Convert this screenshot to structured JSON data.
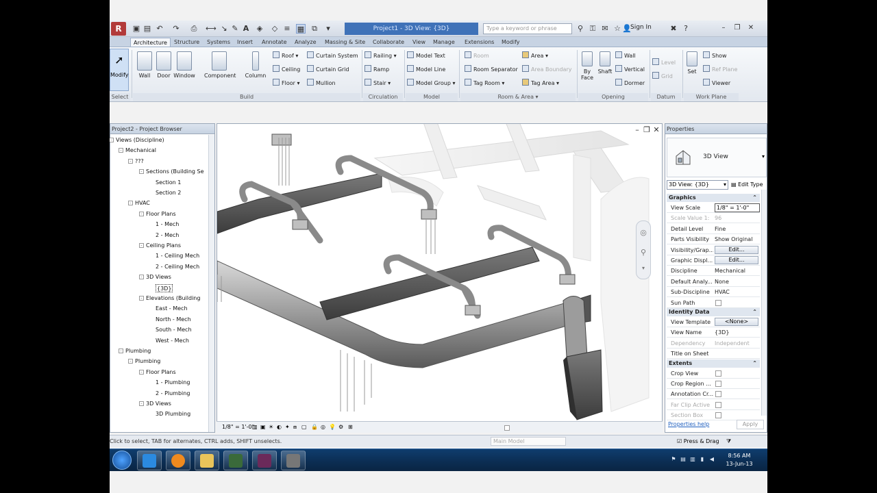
{
  "app": {
    "logo": "R",
    "document_title": "Project1 - 3D View: {3D}",
    "search_placeholder": "Type a keyword or phrase",
    "sign_in": "Sign In"
  },
  "ribbon_tabs": [
    "Architecture",
    "Structure",
    "Systems",
    "Insert",
    "Annotate",
    "Analyze",
    "Massing & Site",
    "Collaborate",
    "View",
    "Manage",
    "Extensions",
    "Modify"
  ],
  "ribbon": {
    "modify": "Modify",
    "build_tools": [
      "Wall",
      "Door",
      "Window",
      "Component",
      "Column"
    ],
    "build_small": [
      "Roof",
      "Ceiling",
      "Floor",
      "Curtain System",
      "Curtain Grid",
      "Mullion"
    ],
    "circulation": [
      "Railing",
      "Ramp",
      "Stair"
    ],
    "model": [
      "Model Text",
      "Model Line",
      "Model Group"
    ],
    "room_area": [
      "Room",
      "Room Separator",
      "Tag Room",
      "Area",
      "Area Boundary",
      "Tag Area"
    ],
    "opening": {
      "by_face": "By Face",
      "shaft": "Shaft",
      "wall": "Wall",
      "vertical": "Vertical",
      "dormer": "Dormer"
    },
    "datum": [
      "Level",
      "Grid"
    ],
    "work_plane": {
      "set": "Set",
      "show": "Show",
      "ref_plane": "Ref Plane",
      "viewer": "Viewer"
    },
    "panel_labels": [
      "Select",
      "Build",
      "Circulation",
      "Model",
      "Room & Area ▾",
      "Opening",
      "Datum",
      "Work Plane"
    ]
  },
  "browser": {
    "title": "Project2 - Project Browser",
    "items": [
      {
        "label": "Views (Discipline)",
        "level": 0,
        "twisty": "-"
      },
      {
        "label": "Mechanical",
        "level": 1,
        "twisty": "-"
      },
      {
        "label": "???",
        "level": 2,
        "twisty": "-"
      },
      {
        "label": "Sections (Building Se",
        "level": 3,
        "twisty": "-"
      },
      {
        "label": "Section 1",
        "level": 4,
        "twisty": ""
      },
      {
        "label": "Section 2",
        "level": 4,
        "twisty": ""
      },
      {
        "label": "HVAC",
        "level": 2,
        "twisty": "-"
      },
      {
        "label": "Floor Plans",
        "level": 3,
        "twisty": "-"
      },
      {
        "label": "1 - Mech",
        "level": 4,
        "twisty": ""
      },
      {
        "label": "2 - Mech",
        "level": 4,
        "twisty": ""
      },
      {
        "label": "Ceiling Plans",
        "level": 3,
        "twisty": "-"
      },
      {
        "label": "1 - Ceiling Mech",
        "level": 4,
        "twisty": ""
      },
      {
        "label": "2 - Ceiling Mech",
        "level": 4,
        "twisty": ""
      },
      {
        "label": "3D Views",
        "level": 3,
        "twisty": "-"
      },
      {
        "label": "{3D}",
        "level": 4,
        "twisty": "",
        "selected": true
      },
      {
        "label": "Elevations (Building",
        "level": 3,
        "twisty": "-"
      },
      {
        "label": "East - Mech",
        "level": 4,
        "twisty": ""
      },
      {
        "label": "North - Mech",
        "level": 4,
        "twisty": ""
      },
      {
        "label": "South - Mech",
        "level": 4,
        "twisty": ""
      },
      {
        "label": "West - Mech",
        "level": 4,
        "twisty": ""
      },
      {
        "label": "Plumbing",
        "level": 1,
        "twisty": "-"
      },
      {
        "label": "Plumbing",
        "level": 2,
        "twisty": "-"
      },
      {
        "label": "Floor Plans",
        "level": 3,
        "twisty": "-"
      },
      {
        "label": "1 - Plumbing",
        "level": 4,
        "twisty": ""
      },
      {
        "label": "2 - Plumbing",
        "level": 4,
        "twisty": ""
      },
      {
        "label": "3D Views",
        "level": 3,
        "twisty": "-"
      },
      {
        "label": "3D Plumbing",
        "level": 4,
        "twisty": ""
      }
    ]
  },
  "view": {
    "scale": "1/8\" = 1'-0\""
  },
  "properties": {
    "title": "Properties",
    "type_name": "3D View",
    "view_select": "3D View: {3D}",
    "edit_type": "Edit Type",
    "sections": [
      {
        "name": "Graphics",
        "rows": [
          {
            "k": "View Scale",
            "v": "1/8\" = 1'-0\"",
            "kind": "box"
          },
          {
            "k": "Scale Value 1:",
            "v": "96",
            "kind": "text",
            "dim": true
          },
          {
            "k": "Detail Level",
            "v": "Fine",
            "kind": "text"
          },
          {
            "k": "Parts Visibility",
            "v": "Show Original",
            "kind": "text"
          },
          {
            "k": "Visibility/Grap...",
            "v": "Edit...",
            "kind": "btn"
          },
          {
            "k": "Graphic Displ...",
            "v": "Edit...",
            "kind": "btn"
          },
          {
            "k": "Discipline",
            "v": "Mechanical",
            "kind": "text"
          },
          {
            "k": "Default Analy...",
            "v": "None",
            "kind": "text"
          },
          {
            "k": "Sub-Discipline",
            "v": "HVAC",
            "kind": "text"
          },
          {
            "k": "Sun Path",
            "v": "",
            "kind": "chk"
          }
        ]
      },
      {
        "name": "Identity Data",
        "rows": [
          {
            "k": "View Template",
            "v": "<None>",
            "kind": "btn"
          },
          {
            "k": "View Name",
            "v": "{3D}",
            "kind": "text"
          },
          {
            "k": "Dependency",
            "v": "Independent",
            "kind": "text",
            "dim": true
          },
          {
            "k": "Title on Sheet",
            "v": "",
            "kind": "text"
          }
        ]
      },
      {
        "name": "Extents",
        "rows": [
          {
            "k": "Crop View",
            "v": "",
            "kind": "chk"
          },
          {
            "k": "Crop Region ...",
            "v": "",
            "kind": "chk"
          },
          {
            "k": "Annotation Cr...",
            "v": "",
            "kind": "chk"
          },
          {
            "k": "Far Clip Active",
            "v": "",
            "kind": "chk",
            "dim": true
          },
          {
            "k": "Section Box",
            "v": "",
            "kind": "chk",
            "dim": true
          }
        ]
      }
    ],
    "help_link": "Properties help",
    "apply": "Apply"
  },
  "status": {
    "message": "Click to select, TAB for alternates, CTRL adds, SHIFT unselects.",
    "press_drag": "Press & Drag",
    "workset": "Main Model"
  },
  "taskbar": {
    "time": "8:56 AM",
    "date": "13-Jun-13"
  },
  "colors": {
    "titlebar_accent": "#3f72b8",
    "taskbar": "#0b2d52"
  }
}
